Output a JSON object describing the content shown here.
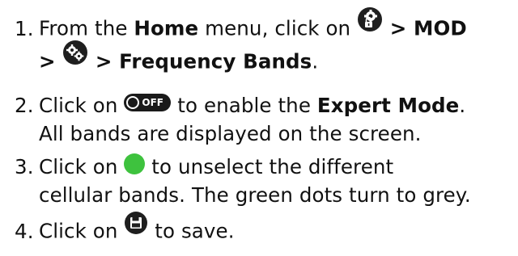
{
  "steps": [
    {
      "number": "1.",
      "line1_text": "From the ",
      "line1_bold": "Home",
      "line1_rest": " menu, click on ",
      "line1_icon": "settings-lock-icon",
      "line1_after": " > MOD",
      "line2_before": "> ",
      "line2_icon": "gears-icon",
      "line2_after": " > Frequency Bands",
      "line2_end": "."
    },
    {
      "number": "2.",
      "line1_text": "Click on ",
      "line1_icon": "off-toggle-icon",
      "toggle_label": "OFF",
      "line1_rest": " to enable the ",
      "line1_bold": "Expert Mode",
      "line1_end": ".",
      "line2_text": "All bands are displayed on the screen."
    },
    {
      "number": "3.",
      "line1_text": "Click on ",
      "line1_icon": "green-dot-icon",
      "line1_rest": " to unselect the different",
      "line2_text": "cellular bands. The green dots turn to grey."
    },
    {
      "number": "4.",
      "line1_text": "Click on ",
      "line1_icon": "save-icon",
      "line1_rest": " to save."
    }
  ],
  "colors": {
    "text": "#111111",
    "icon_dark": "#1f1f1f",
    "green_dot": "#3ec23e"
  }
}
